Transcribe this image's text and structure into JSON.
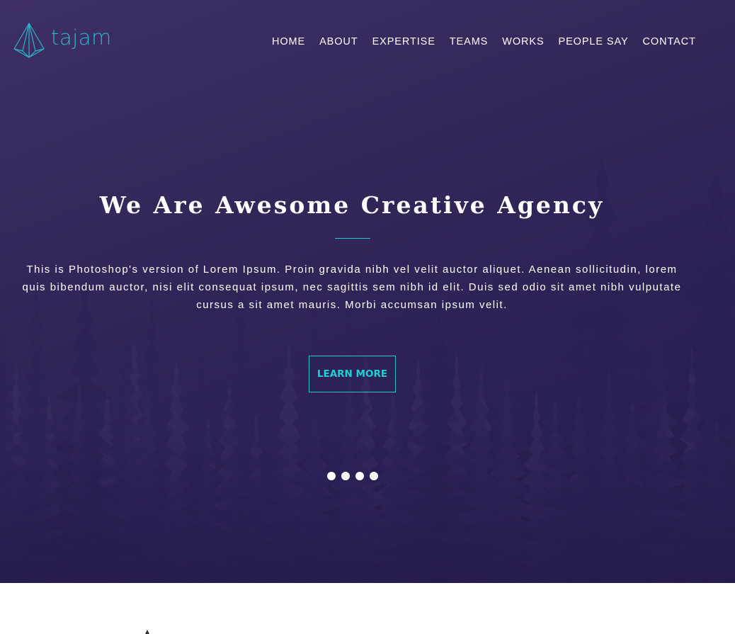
{
  "brand": {
    "name": "tajam",
    "logo_icon": "paper-plane-icon",
    "accent_color": "#2bb5c8"
  },
  "nav": {
    "items": [
      {
        "label": "HOME"
      },
      {
        "label": "ABOUT"
      },
      {
        "label": "EXPERTISE"
      },
      {
        "label": "TEAMS"
      },
      {
        "label": "WORKS"
      },
      {
        "label": "PEOPLE SAY"
      },
      {
        "label": "CONTACT"
      }
    ]
  },
  "hero": {
    "title": "We Are Awesome Creative Agency",
    "description": {
      "line1": "This is Photoshop's version of Lorem Ipsum. Proin gravida nibh vel velit auctor aliquet. Aenean sollicitudin, lorem",
      "line2": "quis bibendum auctor, nisi elit consequat ipsum, nec sagittis sem nibh id elit. Duis sed odio sit amet nibh vulputate cursus a sit amet mauris. Morbi accumsan ipsum velit."
    },
    "cta_label": "LEARN MORE",
    "background_color": "#2f2458",
    "slide_count": 4
  }
}
